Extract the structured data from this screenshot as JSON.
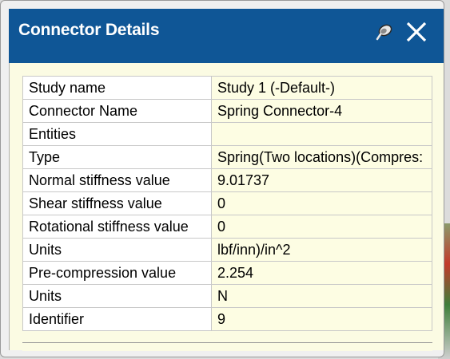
{
  "window": {
    "title": "Connector Details",
    "pin_icon": "pushpin-icon",
    "close_icon": "close-x-icon",
    "titlebar_color": "#0f5696"
  },
  "properties": [
    {
      "label": "Study name",
      "value": "Study 1 (-Default-)"
    },
    {
      "label": "Connector Name",
      "value": "Spring Connector-4"
    },
    {
      "label": "Entities",
      "value": ""
    },
    {
      "label": "Type",
      "value": "Spring(Two locations)(Compres:"
    },
    {
      "label": "Normal stiffness value",
      "value": "9.01737"
    },
    {
      "label": "Shear stiffness value",
      "value": "0"
    },
    {
      "label": "Rotational stiffness value",
      "value": "0"
    },
    {
      "label": "Units",
      "value": "lbf/inn)/in^2"
    },
    {
      "label": "Pre-compression value",
      "value": "2.254"
    },
    {
      "label": "Units",
      "value": "N"
    },
    {
      "label": "Identifier",
      "value": "9"
    }
  ]
}
